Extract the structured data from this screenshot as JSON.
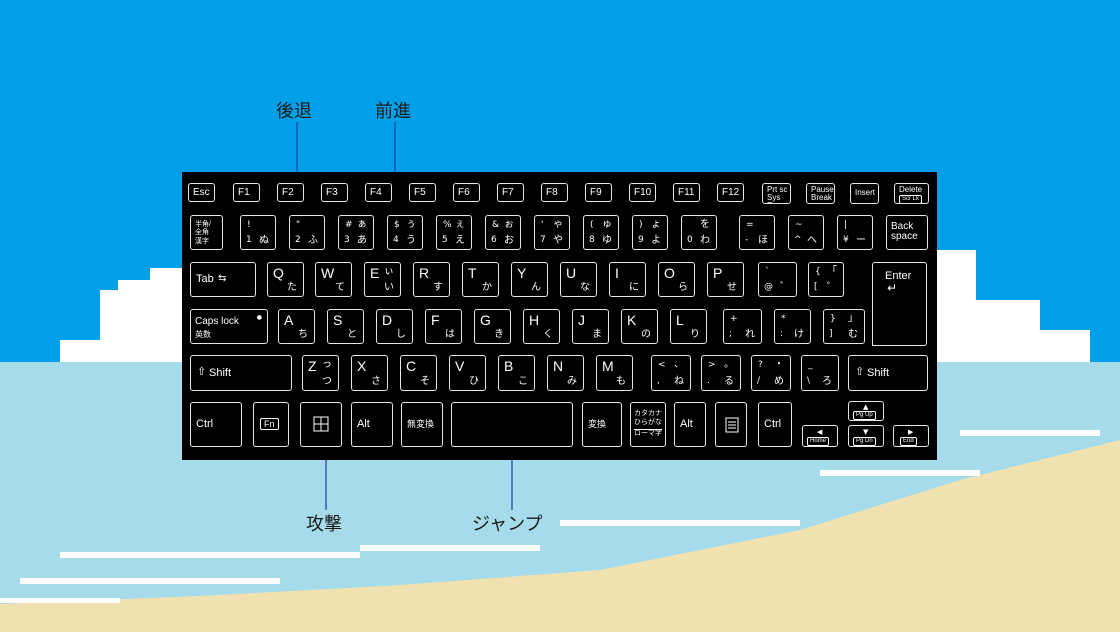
{
  "labels": {
    "back": "後退",
    "forward": "前進",
    "attack": "攻撃",
    "jump": "ジャンプ"
  },
  "colors": {
    "sky": "#00a0e9",
    "sea": "#a6dbeb",
    "sand": "#f0e2b0",
    "cloud": "#ffffff",
    "keyboard": "#000000",
    "pointer_line": "#1f3ba8"
  },
  "keys": {
    "esc": "Esc",
    "f1": "F1",
    "f2": "F2",
    "f3": "F3",
    "f4": "F4",
    "f5": "F5",
    "f6": "F6",
    "f7": "F7",
    "f8": "F8",
    "f9": "F9",
    "f10": "F10",
    "f11": "F11",
    "f12": "F12",
    "prtsc_1": "Prt sc",
    "prtsc_2": "Sys Rq",
    "pause_1": "Pause",
    "pause_2": "Break",
    "insert": "Insert",
    "delete_1": "Delete",
    "delete_2": "Scr Lk",
    "hankaku_1": "半角/",
    "hankaku_2": "全角",
    "hankaku_3": "漢字",
    "n1_t": "!",
    "n1_b": "1",
    "n1_k": "ぬ",
    "n2_t": "\"",
    "n2_b": "2",
    "n2_k": "ふ",
    "n3_t": "#",
    "n3_b": "3",
    "n3_ty": "ぁ",
    "n3_k": "あ",
    "n4_t": "$",
    "n4_b": "4",
    "n4_ty": "ぅ",
    "n4_k": "う",
    "n5_t": "%",
    "n5_b": "5",
    "n5_ty": "ぇ",
    "n5_k": "え",
    "n6_t": "&",
    "n6_b": "6",
    "n6_ty": "ぉ",
    "n6_k": "お",
    "n7_t": "'",
    "n7_b": "7",
    "n7_ty": "ゃ",
    "n7_k": "や",
    "n8_t": "(",
    "n8_b": "8",
    "n8_ty": "ゅ",
    "n8_k": "ゆ",
    "n9_t": ")",
    "n9_b": "9",
    "n9_ty": "ょ",
    "n9_k": "よ",
    "n0_b": "0",
    "n0_ty": "を",
    "n0_k": "わ",
    "minus_t": "=",
    "minus_b": "-",
    "minus_k": "ほ",
    "caret_t": "~",
    "caret_b": "^",
    "caret_k": "へ",
    "yen_t": "|",
    "yen_b": "¥",
    "yen_k": "ー",
    "back_1": "Back",
    "back_2": "space",
    "tab": "Tab",
    "q": "Q",
    "q_k": "た",
    "w": "W",
    "w_k": "て",
    "e": "E",
    "e_ty": "ぃ",
    "e_k": "い",
    "r": "R",
    "r_k": "す",
    "t": "T",
    "t_k": "か",
    "y": "Y",
    "y_k": "ん",
    "u": "U",
    "u_k": "な",
    "i": "I",
    "i_k": "に",
    "o": "O",
    "o_k": "ら",
    "p": "P",
    "p_k": "せ",
    "at_t": "`",
    "at_b": "@",
    "at_k": "゛",
    "bracket_t": "{",
    "bracket_ty": "「",
    "bracket_b": "[",
    "bracket_k": "゜",
    "enter": "Enter",
    "caps_1": "Caps lock",
    "caps_2": "英数",
    "a": "A",
    "a_k": "ち",
    "s": "S",
    "s_k": "と",
    "d": "D",
    "d_k": "し",
    "f": "F",
    "f_k": "は",
    "g": "G",
    "g_k": "き",
    "h": "H",
    "h_k": "く",
    "j": "J",
    "j_k": "ま",
    "k": "K",
    "k_k": "の",
    "l": "L",
    "l_k": "り",
    "semi_t": "+",
    "semi_b": ";",
    "semi_k": "れ",
    "colon_t": "*",
    "colon_b": ":",
    "colon_k": "け",
    "rbr_t": "}",
    "rbr_ty": "」",
    "rbr_b": "]",
    "rbr_k": "む",
    "shift": "Shift",
    "z": "Z",
    "z_ty": "っ",
    "z_k": "つ",
    "x": "X",
    "x_k": "さ",
    "c": "C",
    "c_k": "そ",
    "v": "V",
    "v_k": "ひ",
    "b": "B",
    "b_k": "こ",
    "n": "N",
    "n_k": "み",
    "m": "M",
    "m_k": "も",
    "comma_t": "<",
    "comma_ty": "、",
    "comma_b": ",",
    "comma_k": "ね",
    "period_t": ">",
    "period_ty": "。",
    "period_b": ".",
    "period_k": "る",
    "slash_t": "?",
    "slash_ty": "・",
    "slash_b": "/",
    "slash_k": "め",
    "bs_t": "_",
    "bs_b": "\\",
    "bs_k": "ろ",
    "ctrl": "Ctrl",
    "fn": "Fn",
    "alt": "Alt",
    "muhenkan": "無変換",
    "henkan": "変換",
    "kana_1": "カタカナ",
    "kana_2": "ひらがな",
    "kana_3": "ローマ字",
    "pgup": "Pg Up",
    "pgdn": "Pg Dn",
    "home": "Home",
    "end": "End"
  }
}
